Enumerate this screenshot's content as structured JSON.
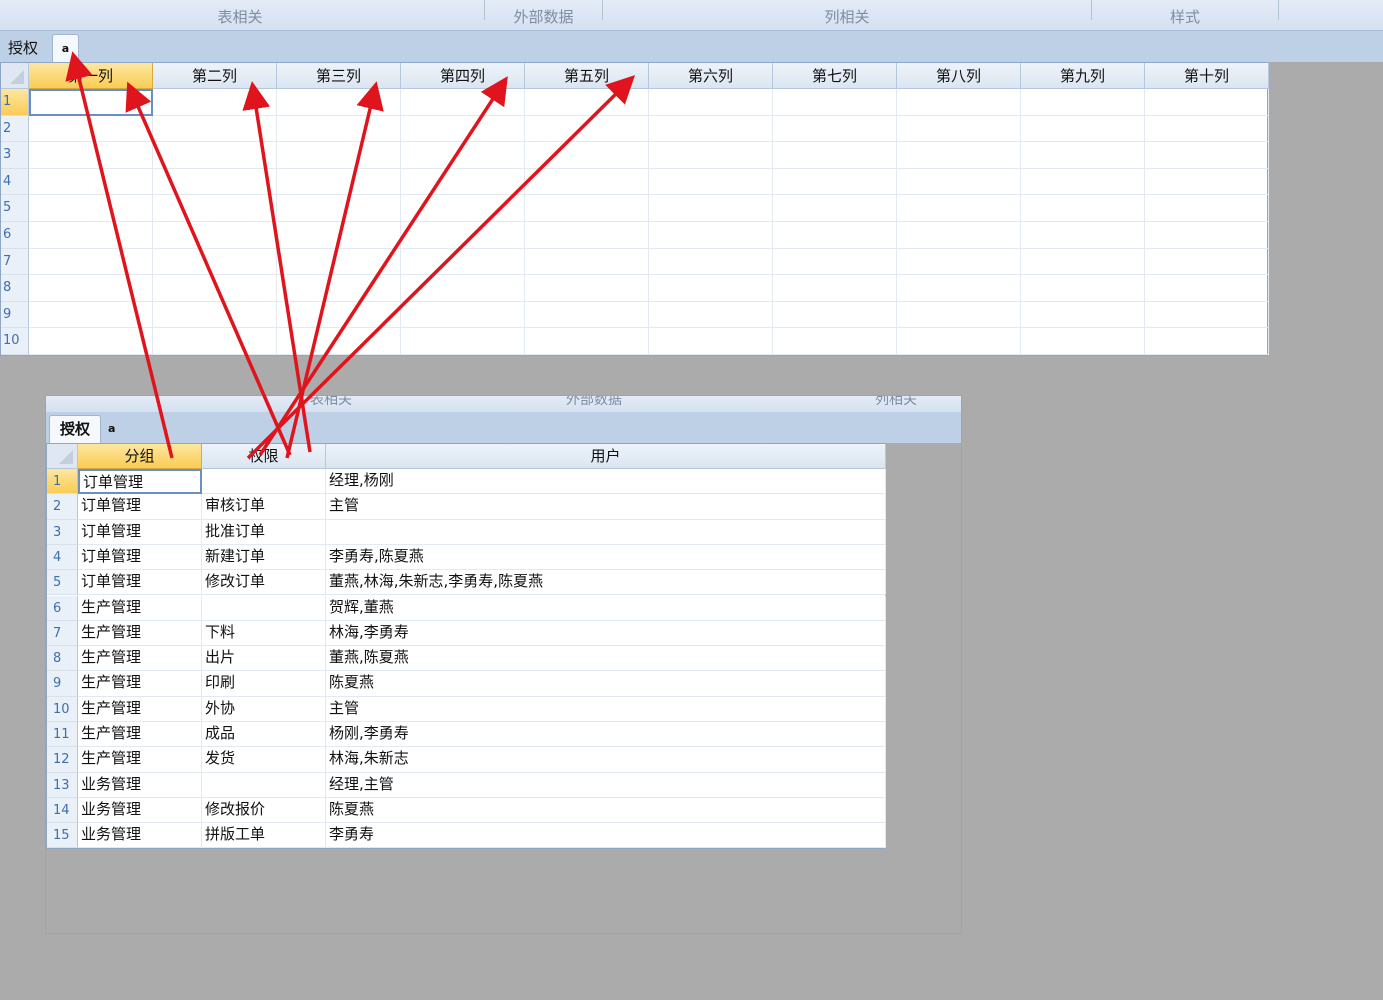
{
  "ribbon": {
    "groups": [
      "表相关",
      "外部数据",
      "列相关",
      "样式"
    ]
  },
  "sheet_tabs": {
    "auth_label": "授权",
    "a_label": "a"
  },
  "grid1": {
    "columns": [
      "第一列",
      "第二列",
      "第三列",
      "第四列",
      "第五列",
      "第六列",
      "第七列",
      "第八列",
      "第九列",
      "第十列"
    ],
    "row_numbers": [
      "1",
      "2",
      "3",
      "4",
      "5",
      "6",
      "7",
      "8",
      "9",
      "10"
    ]
  },
  "window2": {
    "ribbon_groups": [
      "表相关",
      "外部数据",
      "列相关"
    ],
    "tabs": {
      "auth_label": "授权",
      "a_label": "a"
    },
    "columns": [
      "分组",
      "权限",
      "用户"
    ],
    "rows": [
      {
        "num": "1",
        "group": "订单管理",
        "perm": "",
        "users": "经理,杨刚"
      },
      {
        "num": "2",
        "group": "订单管理",
        "perm": "审核订单",
        "users": "主管"
      },
      {
        "num": "3",
        "group": "订单管理",
        "perm": "批准订单",
        "users": ""
      },
      {
        "num": "4",
        "group": "订单管理",
        "perm": "新建订单",
        "users": "李勇寿,陈夏燕"
      },
      {
        "num": "5",
        "group": "订单管理",
        "perm": "修改订单",
        "users": "董燕,林海,朱新志,李勇寿,陈夏燕"
      },
      {
        "num": "6",
        "group": "生产管理",
        "perm": "",
        "users": "贺辉,董燕"
      },
      {
        "num": "7",
        "group": "生产管理",
        "perm": "下料",
        "users": "林海,李勇寿"
      },
      {
        "num": "8",
        "group": "生产管理",
        "perm": "出片",
        "users": "董燕,陈夏燕"
      },
      {
        "num": "9",
        "group": "生产管理",
        "perm": "印刷",
        "users": "陈夏燕"
      },
      {
        "num": "10",
        "group": "生产管理",
        "perm": "外协",
        "users": "主管"
      },
      {
        "num": "11",
        "group": "生产管理",
        "perm": "成品",
        "users": "杨刚,李勇寿"
      },
      {
        "num": "12",
        "group": "生产管理",
        "perm": "发货",
        "users": "林海,朱新志"
      },
      {
        "num": "13",
        "group": "业务管理",
        "perm": "",
        "users": "经理,主管"
      },
      {
        "num": "14",
        "group": "业务管理",
        "perm": "修改报价",
        "users": "陈夏燕"
      },
      {
        "num": "15",
        "group": "业务管理",
        "perm": "拼版工单",
        "users": "李勇寿"
      }
    ]
  },
  "colors": {
    "selected_header": "#f9cc55",
    "arrow": "#e0141c",
    "background": "#ababab"
  }
}
